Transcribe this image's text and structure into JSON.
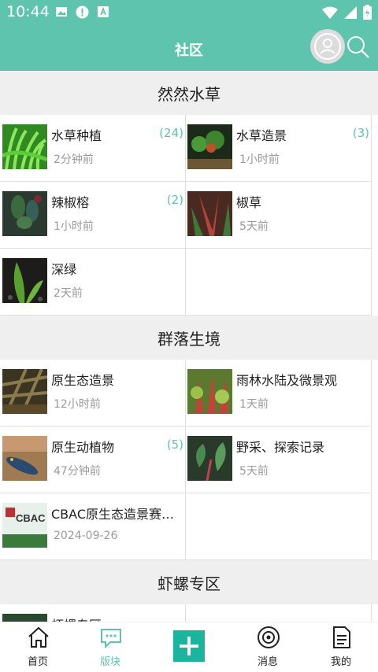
{
  "status": {
    "time": "10:44"
  },
  "header": {
    "title": "社区"
  },
  "sections": [
    {
      "title": "然然水草",
      "items": [
        {
          "name": "水草种植",
          "sub": "2分钟前",
          "count": "(24)"
        },
        {
          "name": "水草造景",
          "sub": "1小时前",
          "count": "(3)"
        },
        {
          "name": "辣椒榕",
          "sub": "1小时前",
          "count": "(2)"
        },
        {
          "name": "椒草",
          "sub": "5天前",
          "count": ""
        },
        {
          "name": "深绿",
          "sub": "2天前",
          "count": ""
        }
      ]
    },
    {
      "title": "群落生境",
      "items": [
        {
          "name": "原生态造景",
          "sub": "12小时前",
          "count": ""
        },
        {
          "name": "雨林水陆及微景观",
          "sub": "1天前",
          "count": ""
        },
        {
          "name": "原生动植物",
          "sub": "47分钟前",
          "count": "(5)"
        },
        {
          "name": "野采、探索记录",
          "sub": "5天前",
          "count": ""
        },
        {
          "name": "CBAC原生态造景赛…",
          "sub": "2024-09-26",
          "count": "",
          "thumb_text": "CBAC"
        }
      ]
    },
    {
      "title": "虾螺专区",
      "items": [
        {
          "name": "虾螺专区",
          "sub": "",
          "count": ""
        }
      ]
    }
  ],
  "nav": {
    "home": "首页",
    "boards": "版块",
    "messages": "消息",
    "mine": "我的"
  },
  "colors": {
    "accent": "#5fc4ae",
    "plus": "#19b59c"
  }
}
